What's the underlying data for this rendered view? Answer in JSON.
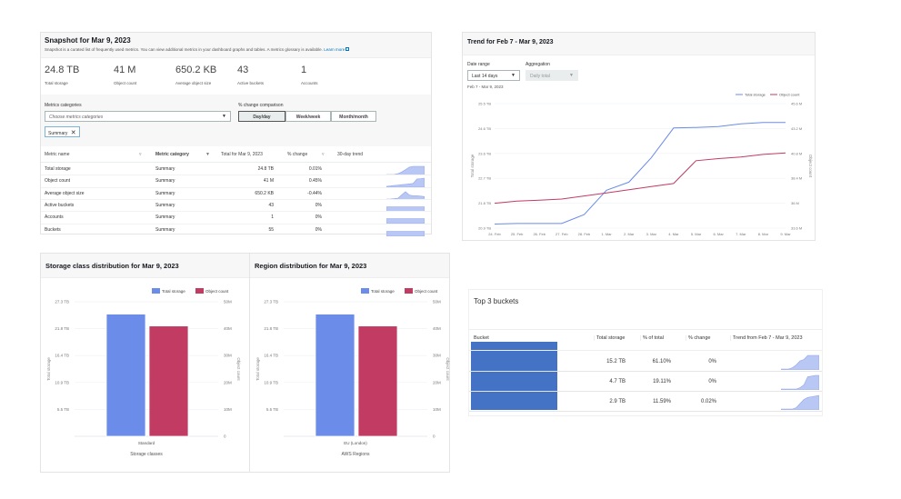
{
  "colors": {
    "storage": "#6b8ce8",
    "objects": "#c23b63",
    "spark": "#b9c7f5",
    "redaction": "#4472c4"
  },
  "snapshot": {
    "title": "Snapshot for Mar 9, 2023",
    "subtitle": "Snapshot is a curated list of frequently used metrics. You can view additional metrics in your dashboard graphs and tables. A metrics glossary is available.",
    "learn_more": "Learn more",
    "metrics": [
      {
        "value": "24.8 TB",
        "label": "Total storage"
      },
      {
        "value": "41 M",
        "label": "Object count"
      },
      {
        "value": "650.2 KB",
        "label": "Average object size"
      },
      {
        "value": "43",
        "label": "Active buckets"
      },
      {
        "value": "1",
        "label": "Accounts"
      }
    ],
    "categories_label": "Metrics categories",
    "categories_placeholder": "Choose metrics categories",
    "chip": "Summary",
    "comparison_label": "% change comparison",
    "comparison_options": [
      "Day/day",
      "Week/week",
      "Month/month"
    ],
    "comparison_selected": "Day/day",
    "columns": [
      "Metric name",
      "Metric category",
      "Total for Mar 9, 2023",
      "% change",
      "30-day trend"
    ],
    "rows": [
      {
        "name": "Total storage",
        "category": "Summary",
        "total": "24.8 TB",
        "change": "0.01%",
        "trend": [
          0,
          0,
          0,
          0.1,
          0.3,
          0.6,
          0.9,
          1,
          1,
          1,
          1
        ]
      },
      {
        "name": "Object count",
        "category": "Summary",
        "total": "41 M",
        "change": "0.45%",
        "trend": [
          0,
          0.05,
          0.1,
          0.15,
          0.2,
          0.25,
          0.3,
          0.35,
          0.9,
          0.95,
          1
        ]
      },
      {
        "name": "Average object size",
        "category": "Summary",
        "total": "650.2 KB",
        "change": "-0.44%",
        "trend": [
          0,
          0,
          0.05,
          0.1,
          0.5,
          0.9,
          0.5,
          0.4,
          0.4,
          0.35,
          0.3
        ]
      },
      {
        "name": "Active buckets",
        "category": "Summary",
        "total": "43",
        "change": "0%",
        "trend": [
          0.5,
          0.5,
          0.5,
          0.5,
          0.5,
          0.5,
          0.5,
          0.5,
          0.5,
          0.5,
          0.5
        ]
      },
      {
        "name": "Accounts",
        "category": "Summary",
        "total": "1",
        "change": "0%",
        "trend": [
          0.5,
          0.5,
          0.5,
          0.5,
          0.5,
          0.5,
          0.5,
          0.5,
          0.5,
          0.5,
          0.5
        ]
      },
      {
        "name": "Buckets",
        "category": "Summary",
        "total": "55",
        "change": "0%",
        "trend": [
          0.5,
          0.5,
          0.5,
          0.5,
          0.5,
          0.5,
          0.5,
          0.5,
          0.5,
          0.5,
          0.5
        ]
      }
    ]
  },
  "trend": {
    "title": "Trend for Feb 7 - Mar 9, 2023",
    "date_range_label": "Date range",
    "date_range_value": "Last 14 days",
    "aggregation_label": "Aggregation",
    "aggregation_value": "Daily total",
    "range_text": "Feb 7 - Mar 9, 2023"
  },
  "chart_data": [
    {
      "type": "line",
      "title": "",
      "x": [
        "24. Feb",
        "25. Feb",
        "26. Feb",
        "27. Feb",
        "28. Feb",
        "1. Mar",
        "2. Mar",
        "3. Mar",
        "4. Mar",
        "5. Mar",
        "6. Mar",
        "7. Mar",
        "8. Mar",
        "9. Mar"
      ],
      "ylabel": "Total storage",
      "y2label": "Object count",
      "yticks": [
        "25.5 TB",
        "24.6 TB",
        "23.6 TB",
        "22.7 TB",
        "21.8 TB",
        "20.9 TB"
      ],
      "ylim": [
        20.9,
        25.5
      ],
      "y2ticks": [
        "45.6 M",
        "43.2 M",
        "40.8 M",
        "38.4 M",
        "36 M",
        "33.6 M"
      ],
      "y2lim": [
        33.6,
        45.6
      ],
      "legend": "top-right",
      "grid": true,
      "series": [
        {
          "name": "Total storage",
          "axis": "left",
          "values": [
            21.05,
            21.07,
            21.07,
            21.07,
            21.4,
            22.3,
            22.6,
            23.5,
            24.6,
            24.62,
            24.65,
            24.75,
            24.8,
            24.8
          ]
        },
        {
          "name": "Object count",
          "axis": "right",
          "values": [
            36,
            36.2,
            36.3,
            36.4,
            36.7,
            37.0,
            37.3,
            37.6,
            37.9,
            40.1,
            40.3,
            40.45,
            40.7,
            40.85
          ]
        }
      ]
    },
    {
      "type": "bar",
      "title": "Storage class distribution for Mar 9, 2023",
      "categories": [
        "Standard"
      ],
      "xlabel": "Storage classes",
      "ylabel": "Total storage",
      "y2label": "Object count",
      "yticks": [
        "27.3 TB",
        "21.8 TB",
        "16.4 TB",
        "10.9 TB",
        "5.5 TB"
      ],
      "ylim": [
        0,
        27.3
      ],
      "y2ticks": [
        "50M",
        "40M",
        "30M",
        "20M",
        "10M",
        "0"
      ],
      "y2lim": [
        0,
        50
      ],
      "legend": "top-right",
      "series": [
        {
          "name": "Total storage",
          "values": [
            24.8
          ]
        },
        {
          "name": "Object count",
          "values": [
            41
          ]
        }
      ]
    },
    {
      "type": "bar",
      "title": "Region distribution for Mar 9, 2023",
      "categories": [
        "EU (London)"
      ],
      "xlabel": "AWS Regions",
      "ylabel": "Total storage",
      "y2label": "Object count",
      "yticks": [
        "27.3 TB",
        "21.8 TB",
        "16.4 TB",
        "10.9 TB",
        "5.5 TB"
      ],
      "ylim": [
        0,
        27.3
      ],
      "y2ticks": [
        "50M",
        "40M",
        "30M",
        "20M",
        "10M",
        "0"
      ],
      "y2lim": [
        0,
        50
      ],
      "legend": "top-right",
      "series": [
        {
          "name": "Total storage",
          "values": [
            24.8
          ]
        },
        {
          "name": "Object count",
          "values": [
            41
          ]
        }
      ]
    }
  ],
  "buckets": {
    "title": "Top 3 buckets",
    "columns": [
      "Bucket",
      "Total storage",
      "% of total",
      "% change",
      "Trend from Feb 7 - Mar 9, 2023"
    ],
    "rows": [
      {
        "storage": "15.2 TB",
        "pct": "61.10%",
        "change": "0%",
        "trend": [
          0,
          0,
          0,
          0.1,
          0.3,
          0.6,
          0.7,
          1,
          1,
          1,
          1
        ]
      },
      {
        "storage": "4.7 TB",
        "pct": "19.11%",
        "change": "0%",
        "trend": [
          0,
          0,
          0,
          0,
          0,
          0.1,
          0.3,
          0.9,
          0.95,
          1,
          1
        ]
      },
      {
        "storage": "2.9 TB",
        "pct": "11.59%",
        "change": "0.02%",
        "trend": [
          0,
          0,
          0,
          0,
          0.1,
          0.4,
          0.7,
          0.85,
          0.9,
          0.95,
          1
        ]
      }
    ]
  }
}
